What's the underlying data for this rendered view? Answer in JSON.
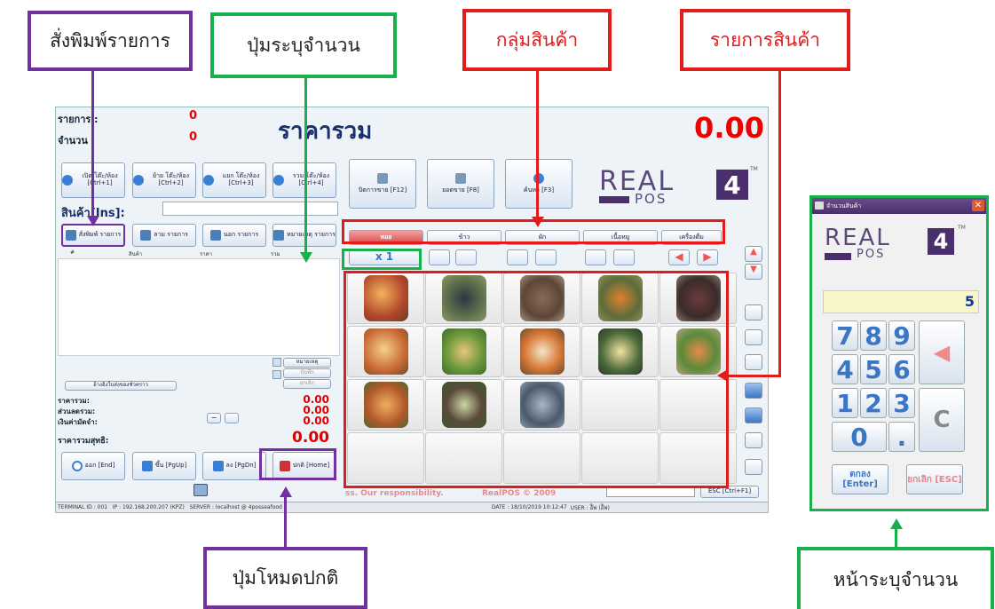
{
  "callouts": {
    "print_list": "สั่งพิมพ์รายการ",
    "qty_button": "ปุ่มระบุจำนวน",
    "product_group": "กลุ่มสินค้า",
    "product_list": "รายการสินค้า",
    "normal_mode": "ปุ่มโหมดปกติ",
    "qty_screen": "หน้าระบุจำนวน"
  },
  "pos": {
    "items_label": "รายการ :",
    "items_value": "0",
    "qty_label": "จำนวน :",
    "qty_value": "0",
    "total_title": "ราคารวม",
    "total_amount": "0.00",
    "table_buttons": [
      {
        "label": "เปิด โต๊ะ/ห้อง [Ctrl+1]"
      },
      {
        "label": "ย้าย โต๊ะ/ห้อง [Ctrl+2]"
      },
      {
        "label": "แยก โต๊ะ/ห้อง [Ctrl+3]"
      },
      {
        "label": "รวม โต๊ะ/ห้อง [Ctrl+4]"
      }
    ],
    "big_buttons": [
      {
        "label": "ปิดการขาย [F12]"
      },
      {
        "label": "ยอดขาย [F8]"
      },
      {
        "label": "ค้นหา [F3]"
      }
    ],
    "product_label": "สินค้า[Ins]:",
    "list_buttons": [
      {
        "label": "สั่งพิมพ์ รายการ"
      },
      {
        "label": "ลาม รายการ"
      },
      {
        "label": "นอก รายการ"
      },
      {
        "label": "หมายเหตุ รายการ"
      }
    ],
    "columns": [
      "#",
      "สินค้า",
      "ราคา",
      "รวม"
    ],
    "note_buttons": [
      "หมายเหตุ",
      "บันทึก",
      "ยกเลิก"
    ],
    "reference_button": "อ้างอิงใบส่งของชั่วคราว",
    "summary": [
      {
        "label": "ราคารวม:",
        "value": "0.00"
      },
      {
        "label": "ส่วนลดรวม:",
        "value": "0.00"
      },
      {
        "label": "เงินค่ามัดจำ:",
        "value": "0.00"
      }
    ],
    "net_label": "ราคารวมสุทธิ:",
    "net_value": "0.00",
    "bottom_buttons": [
      {
        "label": "ออก [End]"
      },
      {
        "label": "ขึ้น [PgUp]"
      },
      {
        "label": "ลง [PgDn]"
      },
      {
        "label": "ปกติ [Home]"
      }
    ],
    "categories": [
      "หอย",
      "ข้าว",
      "ผัก",
      "เนื้อหมู",
      "เครื่องดื่ม"
    ],
    "multiplier": "x 1",
    "footer_text": "ss. Our responsibility.",
    "footer_brand": "RealPOS © 2009",
    "esc_button": "ESC [Ctrl+F1]",
    "status": {
      "terminal": "TERMINAL ID : 001",
      "ip": "IP : 192.168.200.207 (KPZ)",
      "server": "SERVER : localhost @ 4posseafood",
      "date": "DATE : 18/10/2019 10:12:47",
      "user": "USER : อ๊ีฟ (อ๊ีฟ)"
    },
    "logo_text": "REAL",
    "logo_pos": "POS",
    "logo_num": "4",
    "logo_tm": "TM"
  },
  "keypad": {
    "title": "จำนวนสินค้า",
    "display_value": "5",
    "keys": [
      "7",
      "8",
      "9",
      "4",
      "5",
      "6",
      "1",
      "2",
      "3",
      "0",
      "."
    ],
    "clear": "C",
    "ok": "ตกลง [Enter]",
    "cancel": "ยกเลิก [ESC]"
  }
}
